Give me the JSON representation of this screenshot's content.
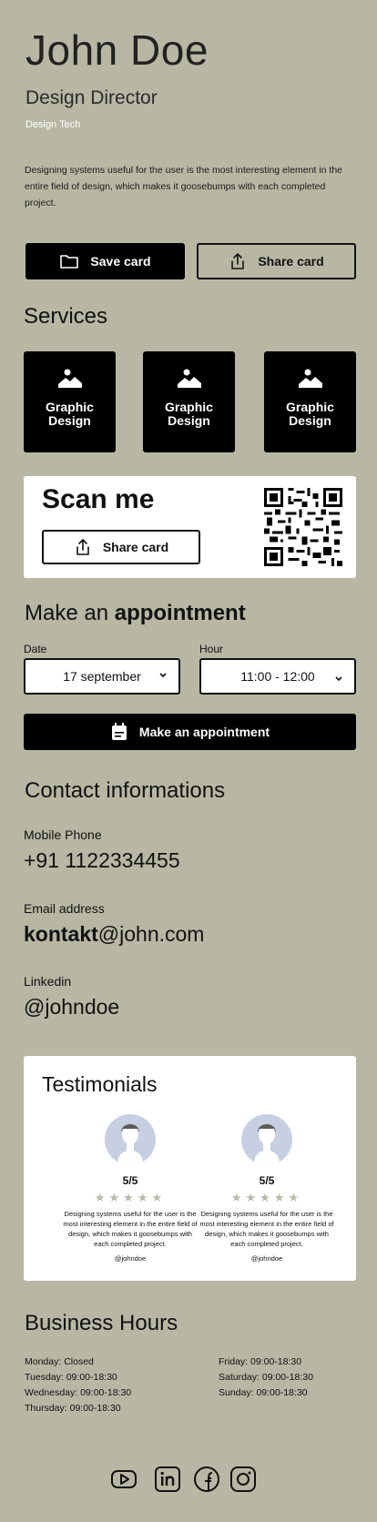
{
  "profile": {
    "name": "John Doe",
    "role": "Design Director",
    "company": "Design Tech",
    "bio": "Designing systems useful for the user is the most interesting element in the entire field of design, which makes it goosebumps with each completed project."
  },
  "actions": {
    "save_label": "Save card",
    "share_label": "Share card"
  },
  "services": {
    "title": "Services",
    "items": [
      {
        "label": "Graphic Design",
        "icon": "image-icon"
      },
      {
        "label": "Graphic Design",
        "icon": "image-icon"
      },
      {
        "label": "Graphic Design",
        "icon": "image-icon"
      }
    ]
  },
  "scan": {
    "title": "Scan me",
    "share_label": "Share card"
  },
  "appointment": {
    "title_prefix": "Make an ",
    "title_bold": "appointment",
    "date_label": "Date",
    "date_value": "17 september",
    "hour_label": "Hour",
    "hour_value": "11:00 - 12:00",
    "button_label": "Make an appointment"
  },
  "contact": {
    "title": "Contact informations",
    "phone_label": "Mobile Phone",
    "phone_value": "+91 1122334455",
    "email_label": "Email address",
    "email_bold": "kontakt",
    "email_rest": "@john.com",
    "linkedin_label": "Linkedin",
    "linkedin_value": "@johndoe"
  },
  "testimonials": {
    "title": "Testimonials",
    "items": [
      {
        "rating": "5/5",
        "stars": 5,
        "text": "Designing systems useful for the user is the most interesting element in the entire field of design, which makes it goosebumps with each completed project.",
        "handle": "@johndoe"
      },
      {
        "rating": "5/5",
        "stars": 5,
        "text": "Designing systems useful for the user is the most interesting element in the entire field of design, which makes it goosebumps with each completed project.",
        "handle": "@johndoe"
      }
    ]
  },
  "business_hours": {
    "title": "Business Hours",
    "left": [
      "Monday: Closed",
      "Tuesday: 09:00-18:30",
      "Wednesday: 09:00-18:30",
      "Thursday: 09:00-18:30"
    ],
    "right": [
      "Friday: 09:00-18:30",
      "Saturday: 09:00-18:30",
      "Sunday: 09:00-18:30"
    ]
  },
  "social": [
    "youtube-icon",
    "linkedin-icon",
    "facebook-icon",
    "instagram-icon"
  ],
  "colors": {
    "background": "#b7b7a4",
    "primary": "#000000",
    "card": "#ffffff",
    "star": "#b9b9a8",
    "avatar": "#c7cfe2"
  }
}
